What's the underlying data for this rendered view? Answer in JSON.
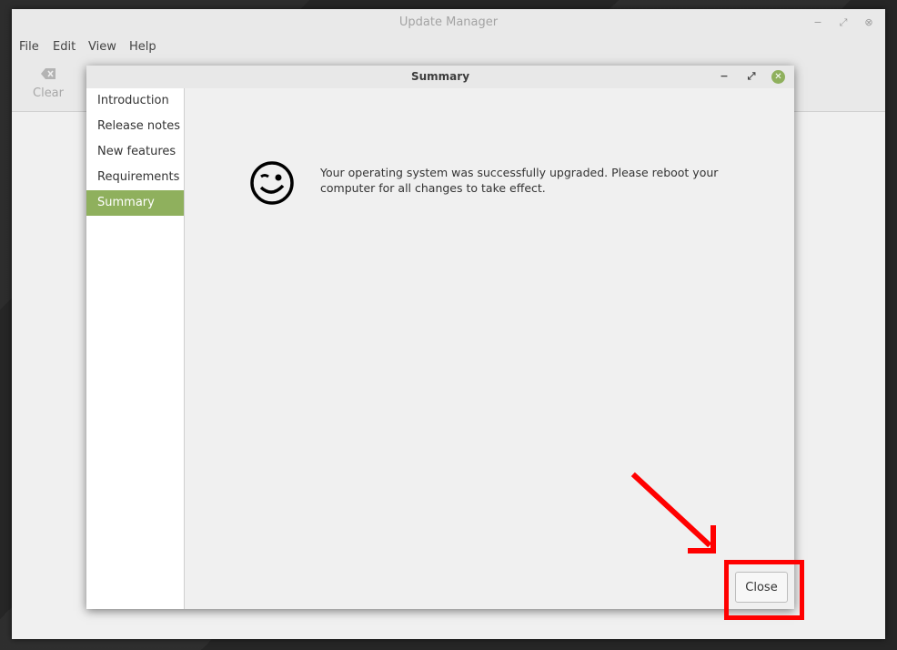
{
  "main_window": {
    "title": "Update Manager",
    "menu": [
      "File",
      "Edit",
      "View",
      "Help"
    ],
    "toolbar": {
      "clear_label": "Clear"
    }
  },
  "dialog": {
    "title": "Summary",
    "sidebar": [
      "Introduction",
      "Release notes",
      "New features",
      "Requirements",
      "Summary"
    ],
    "active_item": "Summary",
    "message": "Your operating system was successfully upgraded. Please reboot your computer for all changes to take effect.",
    "close_button": "Close"
  },
  "colors": {
    "accent": "#8fb05d",
    "annotation": "#ff0000"
  },
  "icons": [
    "clear-icon",
    "minimize-icon",
    "maximize-icon",
    "close-icon",
    "winking-smiley-icon"
  ]
}
